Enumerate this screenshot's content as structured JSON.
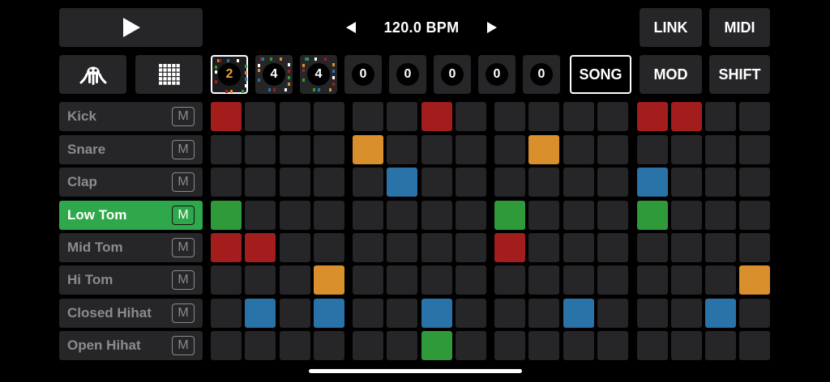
{
  "transport": {
    "play_icon": "play-icon",
    "octo_icon": "octopus-icon",
    "grid_icon": "grid-icon"
  },
  "bpm": {
    "label": "120.0 BPM",
    "dec_icon": "caret-left-icon",
    "inc_icon": "caret-right-icon"
  },
  "buttons": {
    "link": "LINK",
    "midi": "MIDI",
    "song": "SONG",
    "mod": "MOD",
    "shift": "SHIFT"
  },
  "patterns": [
    {
      "value": "2",
      "selected": true,
      "color": "#e8a33a"
    },
    {
      "value": "4",
      "selected": false,
      "color": "#ffffff"
    },
    {
      "value": "4",
      "selected": false,
      "color": "#ffffff"
    },
    {
      "value": "0",
      "selected": false,
      "color": "#ffffff"
    },
    {
      "value": "0",
      "selected": false,
      "color": "#ffffff"
    },
    {
      "value": "0",
      "selected": false,
      "color": "#ffffff"
    },
    {
      "value": "0",
      "selected": false,
      "color": "#ffffff"
    },
    {
      "value": "0",
      "selected": false,
      "color": "#ffffff"
    }
  ],
  "mute_label": "M",
  "tracks": [
    {
      "name": "Kick",
      "active": false
    },
    {
      "name": "Snare",
      "active": false
    },
    {
      "name": "Clap",
      "active": false
    },
    {
      "name": "Low Tom",
      "active": true
    },
    {
      "name": "Mid Tom",
      "active": false
    },
    {
      "name": "Hi Tom",
      "active": false
    },
    {
      "name": "Closed Hihat",
      "active": false
    },
    {
      "name": "Open Hihat",
      "active": false
    }
  ],
  "colors": {
    "red": "#a31d1d",
    "orange": "#d9902c",
    "blue": "#2a73a8",
    "green": "#2e9a3a",
    "cell": "#262628",
    "active_track": "#2ea84a"
  },
  "steps": [
    [
      "red",
      "",
      "",
      "",
      "",
      "",
      "red",
      "",
      "",
      "",
      "",
      "",
      "red",
      "red",
      "",
      ""
    ],
    [
      "",
      "",
      "",
      "",
      "orange",
      "",
      "",
      "",
      "",
      "orange",
      "",
      "",
      "",
      "",
      "",
      ""
    ],
    [
      "",
      "",
      "",
      "",
      "",
      "blue",
      "",
      "",
      "",
      "",
      "",
      "",
      "blue",
      "",
      "",
      ""
    ],
    [
      "green",
      "",
      "",
      "",
      "",
      "",
      "",
      "",
      "green",
      "",
      "",
      "",
      "green",
      "",
      "",
      ""
    ],
    [
      "red",
      "red",
      "",
      "",
      "",
      "",
      "",
      "",
      "red",
      "",
      "",
      "",
      "",
      "",
      "",
      ""
    ],
    [
      "",
      "",
      "",
      "orange",
      "",
      "",
      "",
      "",
      "",
      "",
      "",
      "",
      "",
      "",
      "",
      "orange"
    ],
    [
      "",
      "blue",
      "",
      "blue",
      "",
      "",
      "blue",
      "",
      "",
      "",
      "blue",
      "",
      "",
      "",
      "blue",
      ""
    ],
    [
      "",
      "",
      "",
      "",
      "",
      "",
      "green",
      "",
      "",
      "",
      "",
      "",
      "",
      "",
      "",
      ""
    ]
  ]
}
